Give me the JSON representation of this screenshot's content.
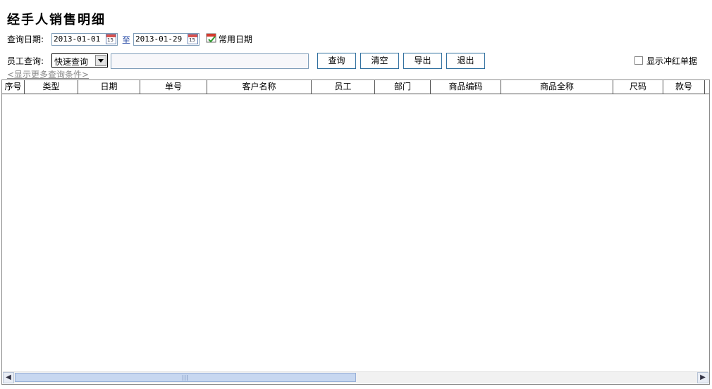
{
  "title": "经手人销售明细",
  "query_date": {
    "label": "查询日期:",
    "start": "2013-01-01",
    "to": "至",
    "end": "2013-01-29",
    "common_dates": "常用日期",
    "calendar_icon_text": "15"
  },
  "employee_query": {
    "label": "员工查询:",
    "mode_selected": "快速查询",
    "input_value": "",
    "input_placeholder": ""
  },
  "buttons": {
    "query": "查询",
    "clear": "清空",
    "export": "导出",
    "exit": "退出"
  },
  "show_reversed": {
    "label": "显示冲红单据",
    "checked": false
  },
  "more_conditions": "<显示更多查询条件>",
  "table": {
    "columns": [
      "序号",
      "类型",
      "日期",
      "单号",
      "客户名称",
      "员工",
      "部门",
      "商品编码",
      "商品全称",
      "尺码",
      "款号"
    ],
    "rows": []
  },
  "colors": {
    "button_border": "#2e6e9e",
    "input_border": "#7f9db9",
    "link_gray": "#8a8a8a",
    "scroll_thumb": "#c7d7f0"
  },
  "icons": [
    "calendar-icon",
    "calendar-check-icon",
    "chevron-down-icon",
    "scroll-left-icon",
    "scroll-right-icon"
  ]
}
